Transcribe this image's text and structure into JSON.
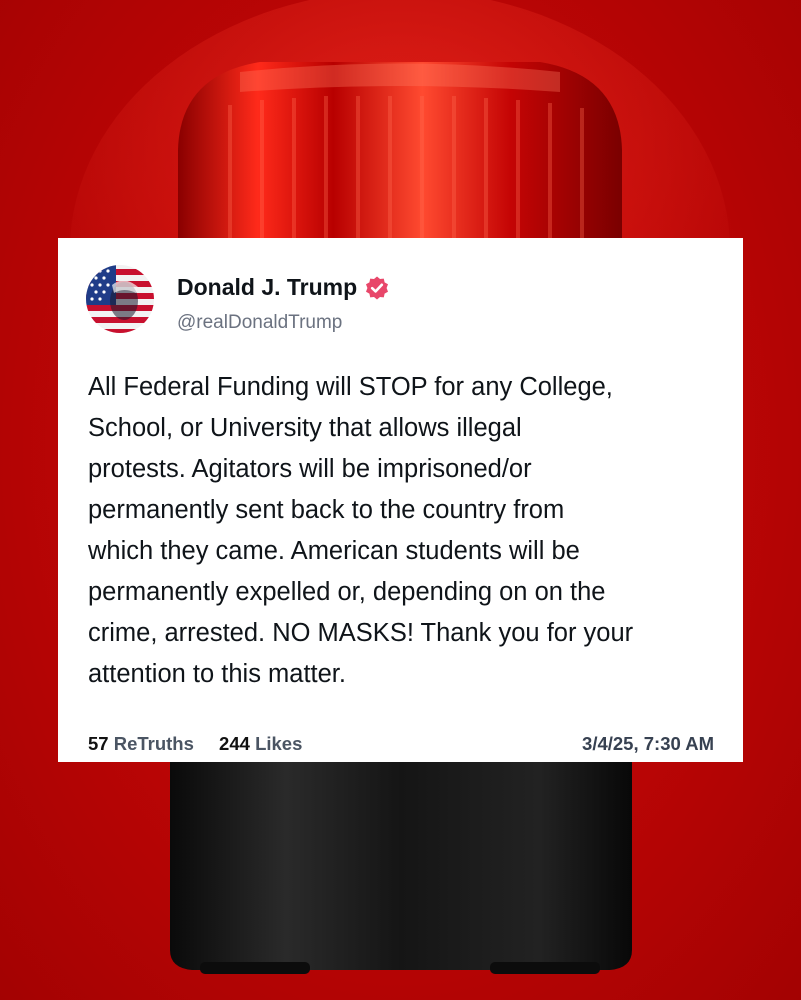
{
  "post": {
    "display_name": "Donald J. Trump",
    "handle": "@realDonaldTrump",
    "verified_icon": "verified-badge-icon",
    "body": "All Federal Funding will STOP for any College,\nSchool, or University that allows illegal\nprotests. Agitators will be imprisoned/or\npermanently sent back to the country from\nwhich they came. American students will be\npermanently expelled or, depending on on the\ncrime, arrested. NO MASKS! Thank you for your\nattention to this matter.",
    "retruths_count": "57",
    "retruths_label": "ReTruths",
    "likes_count": "244",
    "likes_label": "Likes",
    "timestamp": "3/4/25, 7:30 AM"
  },
  "colors": {
    "background": "#c00606",
    "card": "#ffffff",
    "verified_badge": "#e8476a",
    "siren_base": "#1a1a1a"
  }
}
